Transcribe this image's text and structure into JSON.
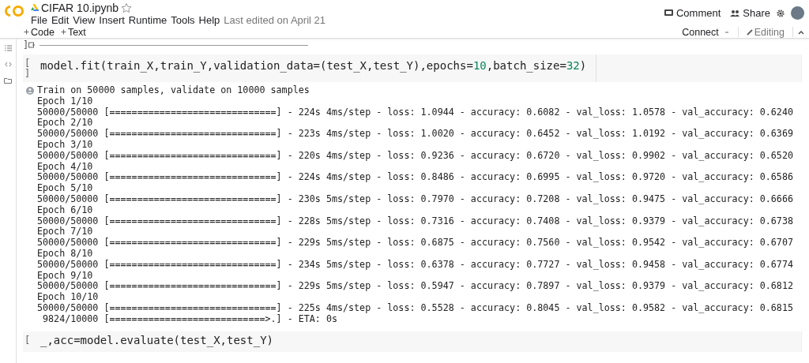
{
  "header": {
    "title": "CIFAR 10.ipynb",
    "menu": [
      "File",
      "Edit",
      "View",
      "Insert",
      "Runtime",
      "Tools",
      "Help"
    ],
    "last_edited": "Last edited on April 21",
    "actions": [
      {
        "kind": "comment",
        "label": "Comment"
      },
      {
        "kind": "share",
        "label": "Share"
      }
    ]
  },
  "toolbar": {
    "add_buttons": [
      "Code",
      "Text"
    ],
    "connect": "Connect",
    "editing": "Editing"
  },
  "previous_cell": {
    "bracket": "]"
  },
  "cells": [
    {
      "kind": "code",
      "prompt_open": "[",
      "prompt_close": "]",
      "code": [
        {
          "kind": "plain",
          "text": "model.fit(train_X,train_Y,validation_data=(test_X,test_Y),epochs="
        },
        {
          "kind": "number",
          "text": "10"
        },
        {
          "kind": "plain",
          "text": ",batch_size="
        },
        {
          "kind": "number",
          "text": "32"
        },
        {
          "kind": "plain",
          "text": ")"
        }
      ],
      "output": [
        "Train on 50000 samples, validate on 10000 samples",
        "Epoch 1/10",
        "50000/50000 [==============================] - 224s 4ms/step - loss: 1.0944 - accuracy: 0.6082 - val_loss: 1.0578 - val_accuracy: 0.6240",
        "Epoch 2/10",
        "50000/50000 [==============================] - 223s 4ms/step - loss: 1.0020 - accuracy: 0.6452 - val_loss: 1.0192 - val_accuracy: 0.6369",
        "Epoch 3/10",
        "50000/50000 [==============================] - 220s 4ms/step - loss: 0.9236 - accuracy: 0.6720 - val_loss: 0.9902 - val_accuracy: 0.6520",
        "Epoch 4/10",
        "50000/50000 [==============================] - 224s 4ms/step - loss: 0.8486 - accuracy: 0.6995 - val_loss: 0.9720 - val_accuracy: 0.6586",
        "Epoch 5/10",
        "50000/50000 [==============================] - 230s 5ms/step - loss: 0.7970 - accuracy: 0.7208 - val_loss: 0.9475 - val_accuracy: 0.6666",
        "Epoch 6/10",
        "50000/50000 [==============================] - 228s 5ms/step - loss: 0.7316 - accuracy: 0.7408 - val_loss: 0.9379 - val_accuracy: 0.6738",
        "Epoch 7/10",
        "50000/50000 [==============================] - 229s 5ms/step - loss: 0.6875 - accuracy: 0.7560 - val_loss: 0.9542 - val_accuracy: 0.6707",
        "Epoch 8/10",
        "50000/50000 [==============================] - 234s 5ms/step - loss: 0.6378 - accuracy: 0.7727 - val_loss: 0.9458 - val_accuracy: 0.6774",
        "Epoch 9/10",
        "50000/50000 [==============================] - 229s 5ms/step - loss: 0.5947 - accuracy: 0.7897 - val_loss: 0.9379 - val_accuracy: 0.6812",
        "Epoch 10/10",
        "50000/50000 [==============================] - 225s 4ms/step - loss: 0.5528 - accuracy: 0.8045 - val_loss: 0.9582 - val_accuracy: 0.6815",
        " 9824/10000 [============================>.] - ETA: 0s"
      ]
    },
    {
      "kind": "code",
      "prompt_open": "[",
      "code": [
        {
          "kind": "plain",
          "text": "_,acc=model.evaluate(test_X,test_Y)"
        }
      ]
    }
  ]
}
